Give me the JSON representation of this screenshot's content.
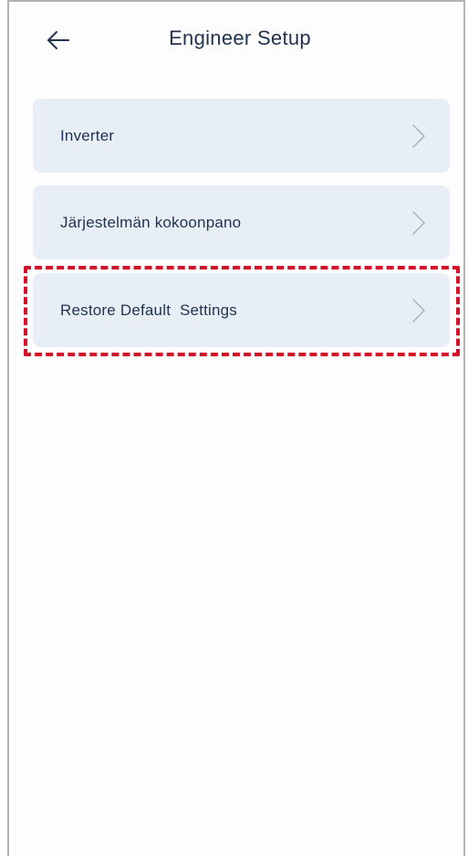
{
  "header": {
    "title": "Engineer Setup",
    "back_icon": "arrow-left-icon"
  },
  "menu": {
    "items": [
      {
        "label": "Inverter",
        "icon": "chevron-right-icon"
      },
      {
        "label": "Järjestelmän kokoonpano",
        "icon": "chevron-right-icon"
      },
      {
        "label": "Restore Default  Settings",
        "icon": "chevron-right-icon"
      }
    ]
  },
  "colors": {
    "text": "#1f3350",
    "item_background": "#e8eef5",
    "highlight": "#d3122a",
    "chevron": "#a9b2bd"
  }
}
